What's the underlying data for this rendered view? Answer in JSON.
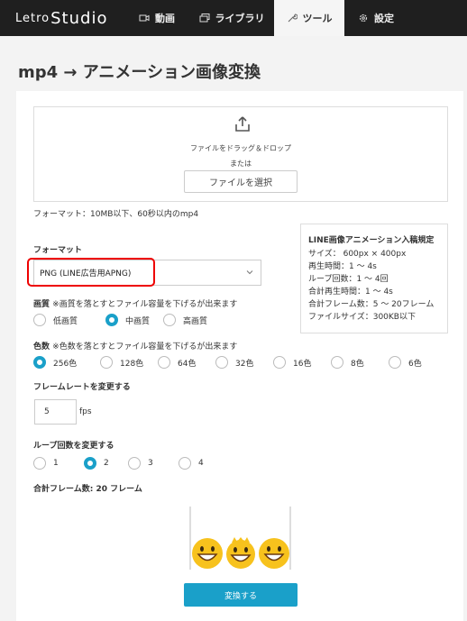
{
  "header": {
    "logo_small": "Letro",
    "logo_big": "Studio",
    "nav": [
      {
        "label": "動画",
        "icon": "video-icon"
      },
      {
        "label": "ライブラリ",
        "icon": "library-icon"
      },
      {
        "label": "ツール",
        "icon": "wrench-icon",
        "active": true
      },
      {
        "label": "設定",
        "icon": "gear-icon"
      }
    ]
  },
  "page": {
    "title": "mp4 → アニメーション画像変換"
  },
  "upload": {
    "drop_text": "ファイルをドラッグ＆ドロップ",
    "or_text": "または",
    "select_button": "ファイルを選択",
    "format_note": "フォーマット：10MB以下、60秒以内のmp4"
  },
  "line_spec": {
    "title": "LINE画像アニメーション入稿規定",
    "rows": [
      "サイズ： 600px × 400px",
      "再生時間：1 ～ 4s",
      "ループ回数：1 ～ 4回",
      "合計再生時間：1 ～ 4s",
      "合計フレーム数：5 ～ 20フレーム",
      "ファイルサイズ：300KB以下"
    ]
  },
  "format": {
    "label": "フォーマット",
    "selected": "PNG (LINE広告用APNG)"
  },
  "quality": {
    "label": "画質",
    "note": "※画質を落とすとファイル容量を下げるが出来ます",
    "options": [
      "低画質",
      "中画質",
      "高画質"
    ],
    "selected_index": 1
  },
  "colors": {
    "label": "色数",
    "note": "※色数を落とすとファイル容量を下げるが出来ます",
    "options": [
      "256色",
      "128色",
      "64色",
      "32色",
      "16色",
      "8色",
      "6色"
    ],
    "selected_index": 0
  },
  "framerate": {
    "label": "フレームレートを変更する",
    "value": "5",
    "unit": "fps"
  },
  "loop": {
    "label": "ループ回数を変更する",
    "options": [
      "1",
      "2",
      "3",
      "4"
    ],
    "selected_index": 1
  },
  "total_frames": {
    "text": "合計フレーム数: 20 フレーム"
  },
  "actions": {
    "convert": "変換する"
  },
  "colors_theme": {
    "accent": "#1aa0c9",
    "header_bg": "#1f1f1f",
    "highlight": "#ee0000"
  }
}
